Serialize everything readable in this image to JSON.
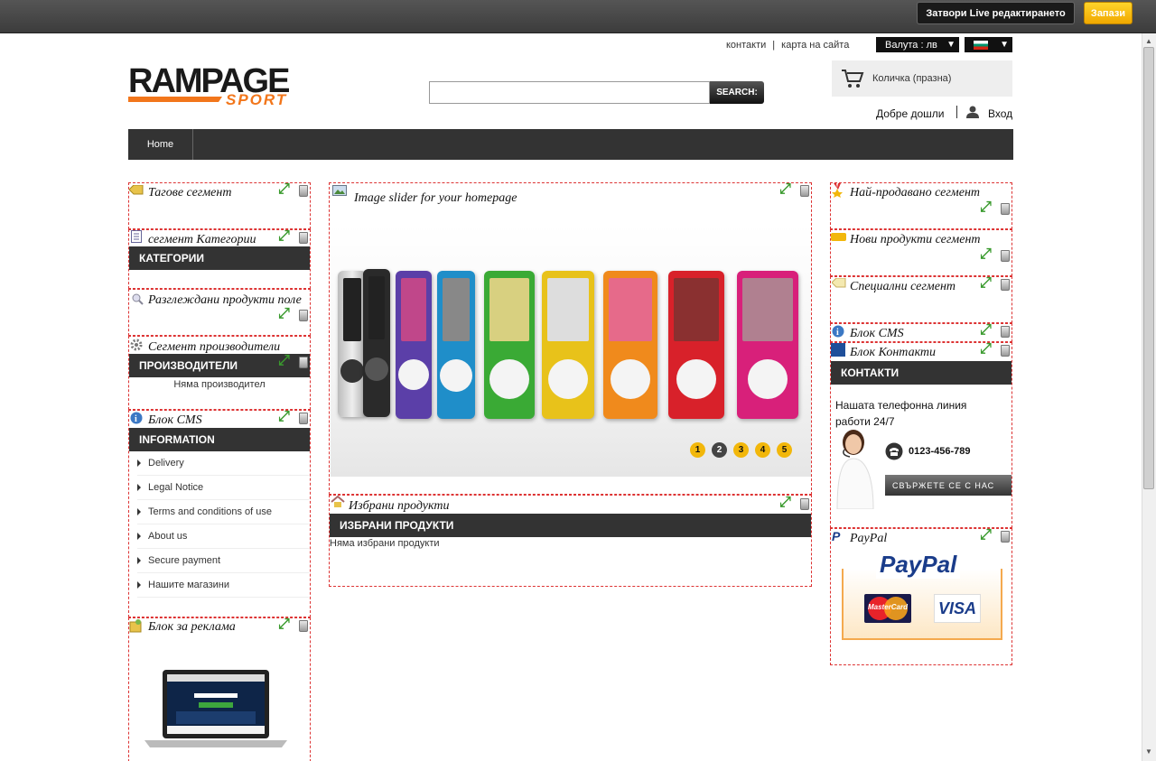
{
  "editor": {
    "close_label": "Затвори Live редактирането",
    "save_label": "Запази"
  },
  "header": {
    "links": {
      "contacts": "контакти",
      "separator": "|",
      "sitemap": "карта на сайта"
    },
    "currency": "Валута : лв",
    "search_button": "SEARCH:",
    "search_value": "",
    "cart": "Количка (празна)",
    "welcome": "Добре дошли",
    "login": "Вход",
    "logo": {
      "main": "RAMPAGE",
      "sub": "SPORT"
    }
  },
  "nav": {
    "home": "Home"
  },
  "left": {
    "tags_title": "Тагове сегмент",
    "categories_title": "сегмент Категории",
    "categories_bar": "КАТЕГОРИИ",
    "viewed_title": "Разглеждани продукти поле",
    "manufacturers_title": "Сегмент производители",
    "manufacturers_bar": "ПРОИЗВОДИТЕЛИ",
    "no_manufacturer": "Няма производител",
    "cms_title": "Блок CMS",
    "info_bar": "INFORMATION",
    "info_items": [
      "Delivery",
      "Legal Notice",
      "Terms and conditions of use",
      "About us",
      "Secure payment",
      "Нашите магазини"
    ],
    "adv_title": "Блок за реклама"
  },
  "center": {
    "slider_title": "Image slider for your homepage",
    "slider_pages": [
      "1",
      "2",
      "3",
      "4",
      "5"
    ],
    "featured_title": "Избрани продукти",
    "featured_bar": "ИЗБРАНИ ПРОДУКТИ",
    "featured_empty": "Няма избрани продукти"
  },
  "right": {
    "bestsellers_title": "Най-продавано сегмент",
    "new_title": "Нови продукти сегмент",
    "specials_title": "Специални сегмент",
    "cms_title": "Блок CMS",
    "contact_title": "Блок Контакти",
    "contact_bar": "КОНТАКТИ",
    "contact_text": "Нашата телефонна линия работи 24/7",
    "phone": "0123-456-789",
    "contact_button": "СВЪРЖЕТЕ СЕ С НАС",
    "paypal_title": "PayPal",
    "paypal_logo": "PayPal",
    "mastercard": "MasterCard",
    "visa": "VISA"
  },
  "colors": {
    "accent": "#f2b70b",
    "dark_bar": "#333333",
    "edit_border": "#dd3333"
  }
}
